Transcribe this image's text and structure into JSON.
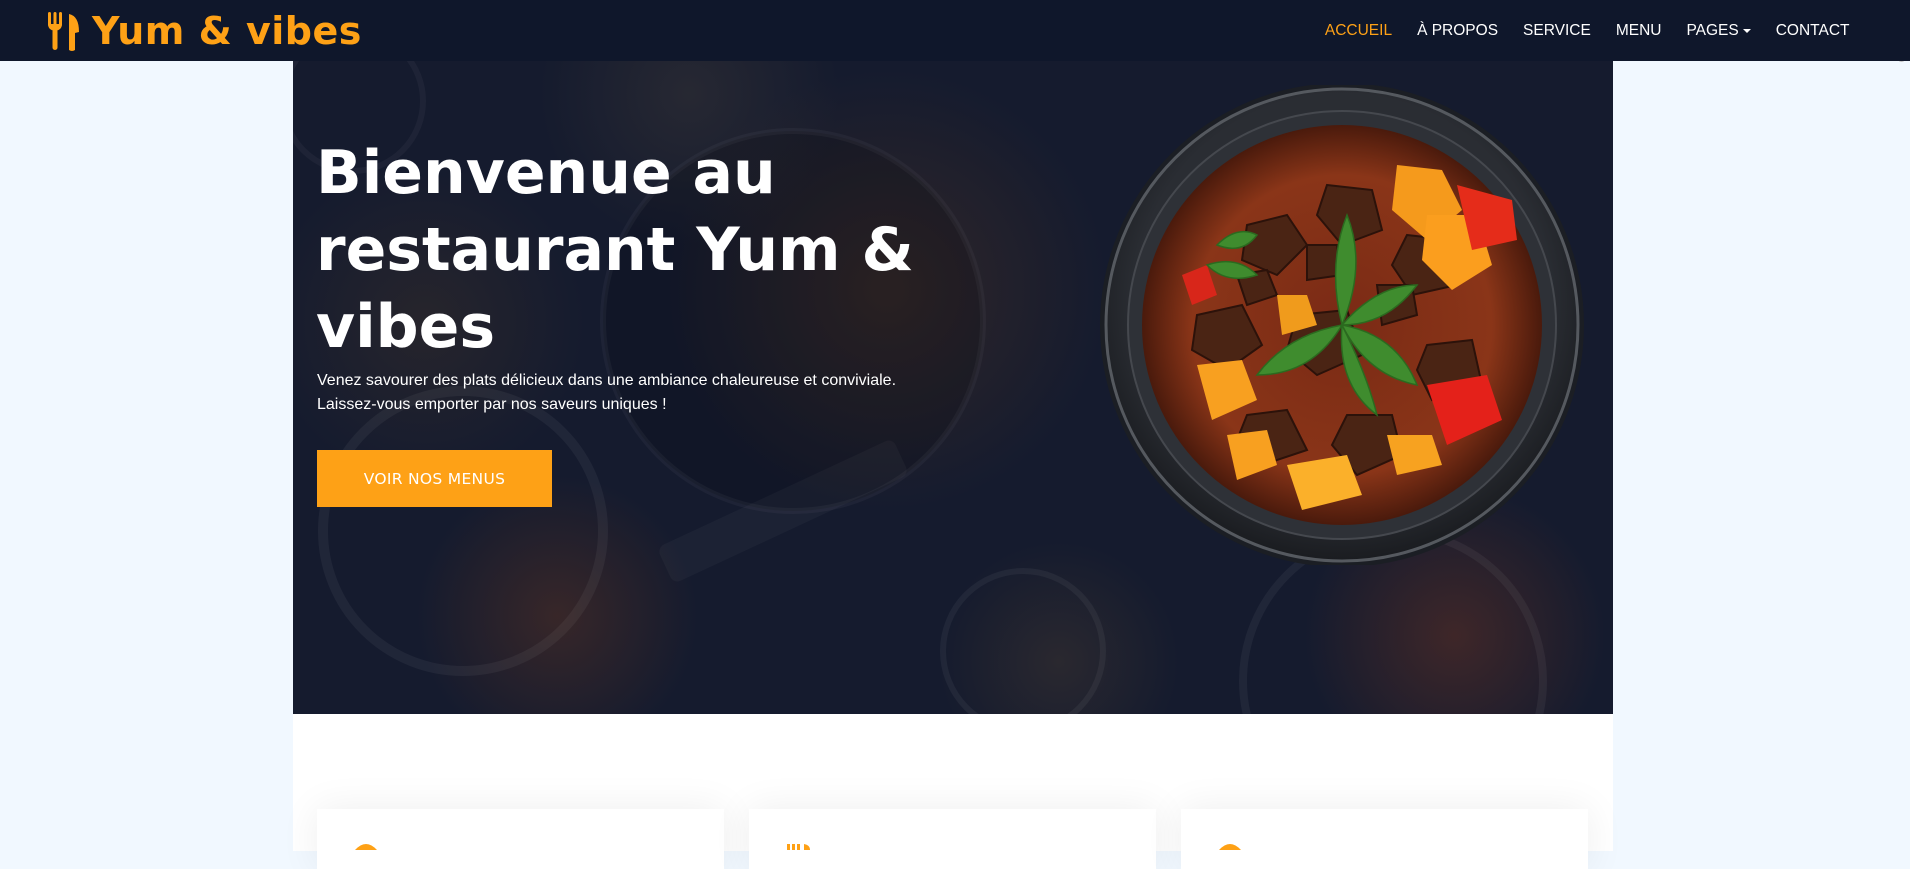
{
  "brand": {
    "name": "Yum & vibes",
    "icon": "utensils-icon",
    "color": "#fea116"
  },
  "nav": {
    "items": [
      {
        "label": "ACCUEIL",
        "active": true
      },
      {
        "label": "À PROPOS",
        "active": false
      },
      {
        "label": "SERVICE",
        "active": false
      },
      {
        "label": "MENU",
        "active": false
      },
      {
        "label": "PAGES",
        "active": false,
        "dropdown": true
      },
      {
        "label": "CONTACT",
        "active": false
      }
    ]
  },
  "hero": {
    "title": "Bienvenue au restaurant Yum & vibes",
    "subtitle": "Venez savourer des plats délicieux dans une ambiance chaleureuse et conviviale. Laissez-vous emporter par nos saveurs uniques !",
    "cta_label": "VOIR NOS MENUS",
    "image": "beef-stew-bowl"
  },
  "services": {
    "cards": [
      {
        "icon": "user-tie-icon"
      },
      {
        "icon": "utensils-icon"
      },
      {
        "icon": "cart-plus-icon"
      }
    ]
  },
  "colors": {
    "primary": "#fea116",
    "dark": "#0f172b",
    "light": "#f1f8ff"
  }
}
